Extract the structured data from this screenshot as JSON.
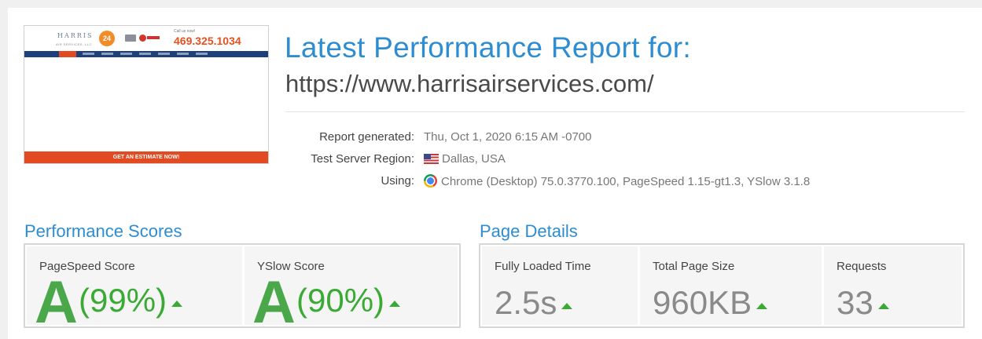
{
  "thumbnail": {
    "logo_text": "HARRIS",
    "logo_sub": "AIR SERVICES, LLC",
    "badge_24": "24",
    "call_label": "Call us now!",
    "phone": "469.325.1034",
    "cta": "GET AN ESTIMATE NOW!"
  },
  "header": {
    "title": "Latest Performance Report for:",
    "url": "https://www.harrisairservices.com/"
  },
  "meta": {
    "generated_label": "Report generated:",
    "generated_value": "Thu, Oct 1, 2020 6:15 AM -0700",
    "region_label": "Test Server Region:",
    "region_value": "Dallas, USA",
    "using_label": "Using:",
    "using_value": "Chrome (Desktop) 75.0.3770.100, PageSpeed 1.15-gt1.3, YSlow 3.1.8"
  },
  "performance": {
    "title": "Performance Scores",
    "pagespeed_label": "PageSpeed Score",
    "pagespeed_grade": "A",
    "pagespeed_pct": "(99%)",
    "yslow_label": "YSlow Score",
    "yslow_grade": "A",
    "yslow_pct": "(90%)"
  },
  "details": {
    "title": "Page Details",
    "load_label": "Fully Loaded Time",
    "load_value": "2.5s",
    "size_label": "Total Page Size",
    "size_value": "960KB",
    "requests_label": "Requests",
    "requests_value": "33"
  },
  "colors": {
    "accent_blue": "#2e8dd0",
    "grade_green": "#3aaa35",
    "cta_orange": "#e24b21"
  }
}
